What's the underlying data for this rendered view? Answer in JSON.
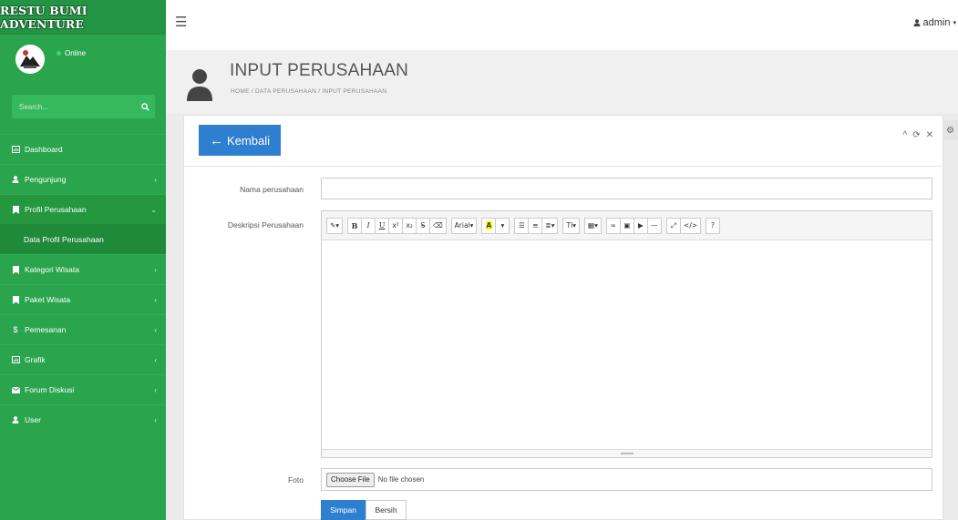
{
  "brand": "RESTU BUMI ADVENTURE",
  "user_panel": {
    "status": "Online"
  },
  "search": {
    "placeholder": "Search..."
  },
  "menu": {
    "dashboard": "Dashboard",
    "pengunjung": "Pengunjung",
    "profil": "Profil Perusahaan",
    "profil_sub": "Data Profil Perusahaan",
    "kategori": "Kategori Wisata",
    "paket": "Paket Wisata",
    "pemesanan": "Pemesanan",
    "grafik": "Grafik",
    "forum": "Forum Diskusi",
    "user": "User"
  },
  "navbar": {
    "admin": "admin"
  },
  "header": {
    "title": "INPUT PERUSAHAAN",
    "breadcrumb": "HOME  /  DATA PERUSAHAAN  /  INPUT PERUSAHAAN"
  },
  "panel": {
    "back_label": "Kembali"
  },
  "form": {
    "nama_label": "Nama perusahaan",
    "nama_value": "",
    "deskripsi_label": "Deskripsi Perusahaan",
    "foto_label": "Foto",
    "file_button": "Choose File",
    "file_status": "No file chosen",
    "simpan": "Simpan",
    "bersih": "Bersih"
  },
  "editor": {
    "font_name": "Arial",
    "text_size": "TI"
  },
  "colors": {
    "sidebar": "#2aa54d",
    "primary": "#2e7fd0"
  }
}
